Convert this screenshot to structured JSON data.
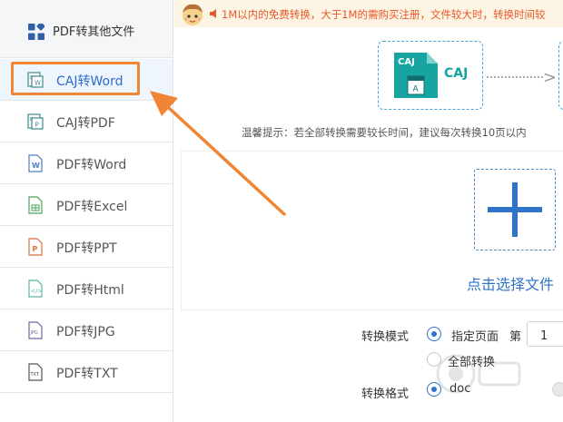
{
  "sidebar": {
    "header_title": "PDF转其他文件",
    "items": [
      {
        "label": "CAJ转Word",
        "icon": "caj-word-icon"
      },
      {
        "label": "CAJ转PDF",
        "icon": "caj-pdf-icon"
      },
      {
        "label": "PDF转Word",
        "icon": "word-icon"
      },
      {
        "label": "PDF转Excel",
        "icon": "excel-icon"
      },
      {
        "label": "PDF转PPT",
        "icon": "ppt-icon"
      },
      {
        "label": "PDF转Html",
        "icon": "html-icon"
      },
      {
        "label": "PDF转JPG",
        "icon": "jpg-icon"
      },
      {
        "label": "PDF转TXT",
        "icon": "txt-icon"
      }
    ],
    "active_index": 0
  },
  "banner": {
    "text": "1M以内的免费转换，大于1M的需购买注册，文件较大时，转换时间较"
  },
  "flow": {
    "source_badge": "CAJ",
    "source_label": "CAJ"
  },
  "tip": "温馨提示：若全部转换需要较长时间，建议每次转换10页以内",
  "upload": {
    "label": "点击选择文件"
  },
  "options": {
    "mode_label": "转换模式",
    "mode_selected": "指定页面",
    "page_prefix": "第",
    "page_value": "1",
    "mode_all": "全部转换",
    "format_label": "转换格式",
    "format_selected": "doc"
  },
  "colors": {
    "accent": "#2f74c8",
    "highlight": "#f08536",
    "banner_text": "#e8572a",
    "caj_teal": "#16a3a0"
  }
}
